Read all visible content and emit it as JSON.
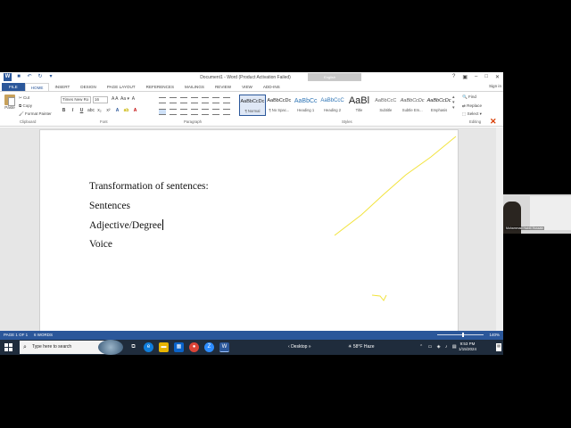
{
  "window": {
    "title": "Document1 - Word (Product Activation Failed)",
    "sign_in_box": "English",
    "sign_in": "Sign in"
  },
  "tabs": [
    "FILE",
    "HOME",
    "INSERT",
    "DESIGN",
    "PAGE LAYOUT",
    "REFERENCES",
    "MAILINGS",
    "REVIEW",
    "VIEW",
    "ADD-INS"
  ],
  "ribbon": {
    "clipboard": {
      "paste": "Paste",
      "cut": "Cut",
      "copy": "Copy",
      "format_painter": "Format Painter",
      "label": "Clipboard"
    },
    "font": {
      "name": "Times New Ro",
      "size": "16",
      "label": "Font"
    },
    "paragraph": {
      "label": "Paragraph"
    },
    "styles": {
      "label": "Styles",
      "items": [
        {
          "sample": "AaBbCcDc",
          "name": "¶ Normal"
        },
        {
          "sample": "AaBbCcDc",
          "name": "¶ No Spac..."
        },
        {
          "sample": "AaBbCc",
          "name": "Heading 1"
        },
        {
          "sample": "AaBbCcC",
          "name": "Heading 2"
        },
        {
          "sample": "AaBl",
          "name": "Title"
        },
        {
          "sample": "AaBbCcC",
          "name": "Subtitle"
        },
        {
          "sample": "AaBbCcDc",
          "name": "Subtle Em..."
        },
        {
          "sample": "AaBbCcDc",
          "name": "Emphasis"
        }
      ]
    },
    "editing": {
      "find": "Find",
      "replace": "Replace",
      "select": "Select",
      "label": "Editing"
    }
  },
  "document": {
    "lines": [
      "Transformation of sentences:",
      "Sentences",
      "Adjective/Degree",
      "Voice"
    ]
  },
  "status": {
    "page": "PAGE 1 OF 1",
    "words": "6 WORDS",
    "zoom": "140%"
  },
  "taskbar": {
    "search_placeholder": "Type here to search",
    "desktop": "Desktop",
    "weather_temp": "58°F",
    "weather_text": "Haze",
    "time": "9:53 PM",
    "date": "1/15/2024"
  },
  "webcam": {
    "name": "Muhammad Habib Hussain"
  },
  "colors": {
    "word_blue": "#2b579a",
    "ink_yellow": "#f2e33c",
    "taskbar": "#1f2c3c"
  }
}
